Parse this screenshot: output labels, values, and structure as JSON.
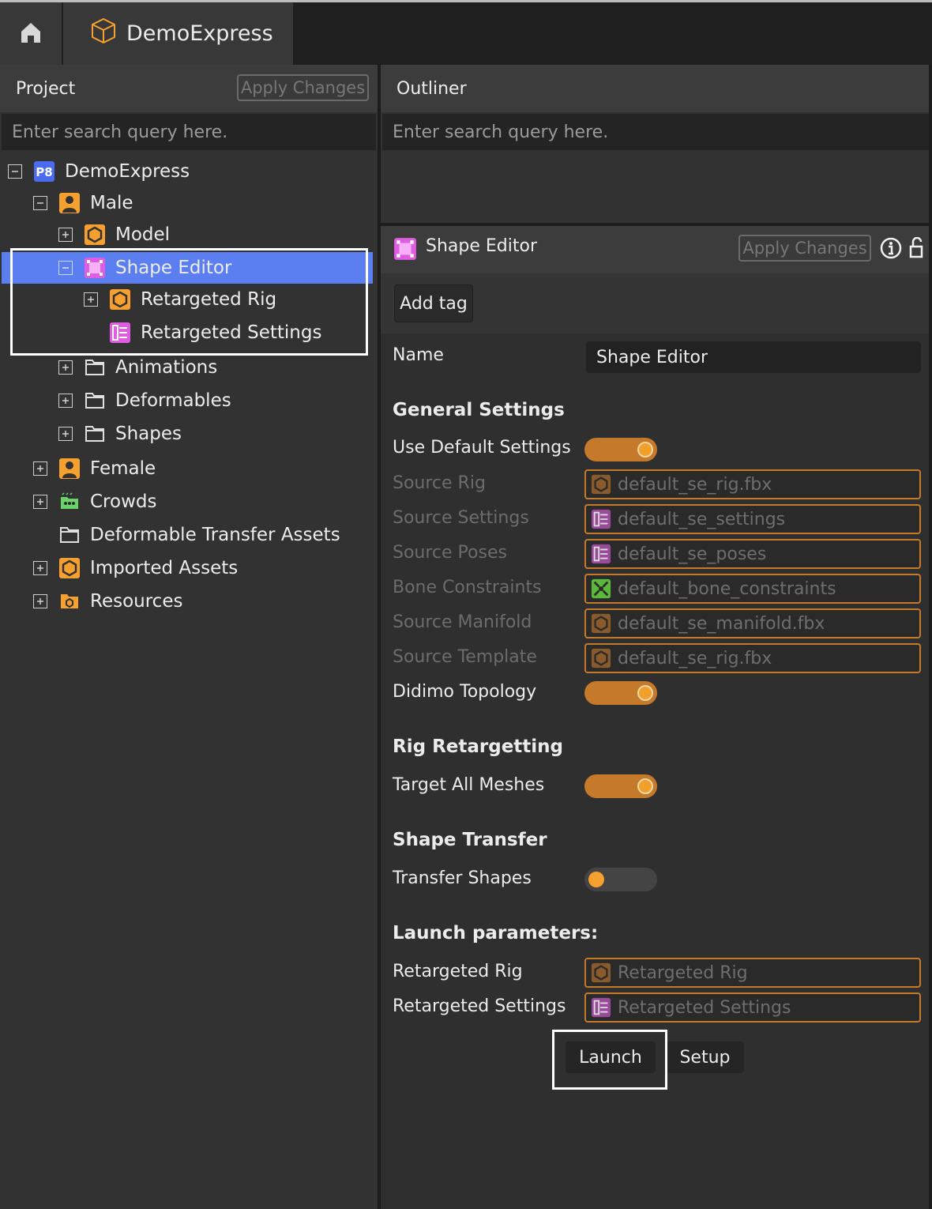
{
  "topbar": {
    "home_icon": "home-icon",
    "tab_label": "DemoExpress",
    "tab_icon": "cube-outline-icon"
  },
  "project": {
    "title": "Project",
    "apply_label": "Apply Changes",
    "search_placeholder": "Enter search query here.",
    "tree": {
      "root": "DemoExpress",
      "male": "Male",
      "model": "Model",
      "shape_editor": "Shape Editor",
      "retargeted_rig": "Retargeted Rig",
      "retargeted_settings": "Retargeted Settings",
      "animations": "Animations",
      "deformables": "Deformables",
      "shapes": "Shapes",
      "female": "Female",
      "crowds": "Crowds",
      "deformable_transfer": "Deformable Transfer Assets",
      "imported_assets": "Imported Assets",
      "resources": "Resources",
      "root_badge": "P8"
    }
  },
  "outliner": {
    "title": "Outliner",
    "search_placeholder": "Enter search query here."
  },
  "inspector": {
    "title": "Shape Editor",
    "apply_label": "Apply Changes",
    "add_tag": "Add tag",
    "name_label": "Name",
    "name_value": "Shape Editor",
    "general_settings": "General Settings",
    "use_default_settings": "Use Default Settings",
    "use_default_settings_on": true,
    "source_rig_label": "Source Rig",
    "source_rig_value": "default_se_rig.fbx",
    "source_settings_label": "Source Settings",
    "source_settings_value": "default_se_settings",
    "source_poses_label": "Source Poses",
    "source_poses_value": "default_se_poses",
    "bone_constraints_label": "Bone Constraints",
    "bone_constraints_value": "default_bone_constraints",
    "source_manifold_label": "Source Manifold",
    "source_manifold_value": "default_se_manifold.fbx",
    "source_template_label": "Source Template",
    "source_template_value": "default_se_rig.fbx",
    "didimo_topology": "Didimo Topology",
    "didimo_topology_on": true,
    "rig_retargetting": "Rig Retargetting",
    "target_all_meshes": "Target All Meshes",
    "target_all_meshes_on": true,
    "shape_transfer": "Shape Transfer",
    "transfer_shapes": "Transfer Shapes",
    "transfer_shapes_on": false,
    "launch_parameters": "Launch parameters:",
    "lp_rig_label": "Retargeted Rig",
    "lp_rig_value": "Retargeted Rig",
    "lp_settings_label": "Retargeted Settings",
    "lp_settings_value": "Retargeted Settings",
    "launch": "Launch",
    "setup": "Setup"
  },
  "colors": {
    "accent_orange": "#f5a02f",
    "selection_blue": "#5b7ff0",
    "shape_editor_pink": "#e05ce0",
    "crowds_green": "#6ad36a"
  }
}
